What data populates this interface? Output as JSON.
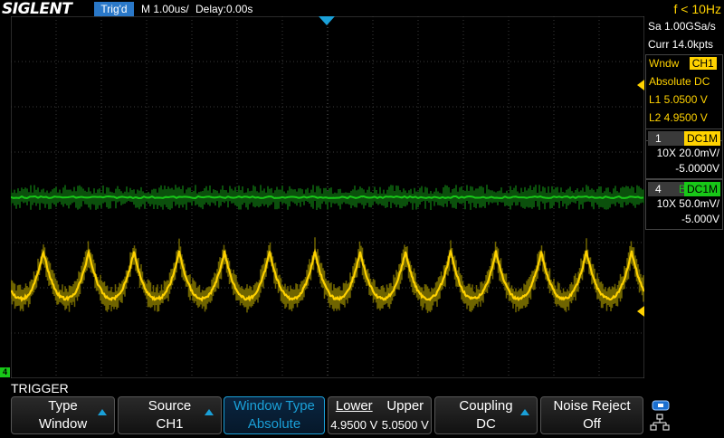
{
  "header": {
    "brand": "SIGLENT",
    "trigger_status": "Trig'd",
    "timebase": "M 1.00us/",
    "delay": "Delay:0.00s",
    "frequency": "f < 10Hz"
  },
  "right_panel": {
    "sample_rate": "Sa 1.00GSa/s",
    "memory": "Curr 14.0kpts",
    "window": {
      "label": "Wndw",
      "source": "CH1",
      "mode": "Absolute DC",
      "l1": "L1  5.0500 V",
      "l2": "L2  4.9500 V"
    },
    "ch1": {
      "num": "1",
      "coupling": "DC1M",
      "scale": "10X  20.0mV/",
      "offset": "-5.0000V"
    },
    "ch4": {
      "num": "4",
      "bw": "B",
      "coupling": "DC1M",
      "scale": "10X  50.0mV/",
      "offset": "-5.000V"
    }
  },
  "menu": {
    "title": "TRIGGER",
    "type": {
      "label": "Type",
      "value": "Window"
    },
    "source": {
      "label": "Source",
      "value": "CH1"
    },
    "window_type": {
      "label": "Window Type",
      "value": "Absolute"
    },
    "lower": {
      "label": "Lower",
      "value": "4.9500 V"
    },
    "upper": {
      "label": "Upper",
      "value": "5.0500 V"
    },
    "coupling": {
      "label": "Coupling",
      "value": "DC"
    },
    "noise_reject": {
      "label": "Noise Reject",
      "value": "Off"
    }
  },
  "ground_marker": "4",
  "colors": {
    "ch1": "#ffd200",
    "ch4": "#18c818",
    "accent": "#1aa0d8",
    "background": "#000000"
  },
  "icons": [
    "usb-icon",
    "network-icon"
  ]
}
